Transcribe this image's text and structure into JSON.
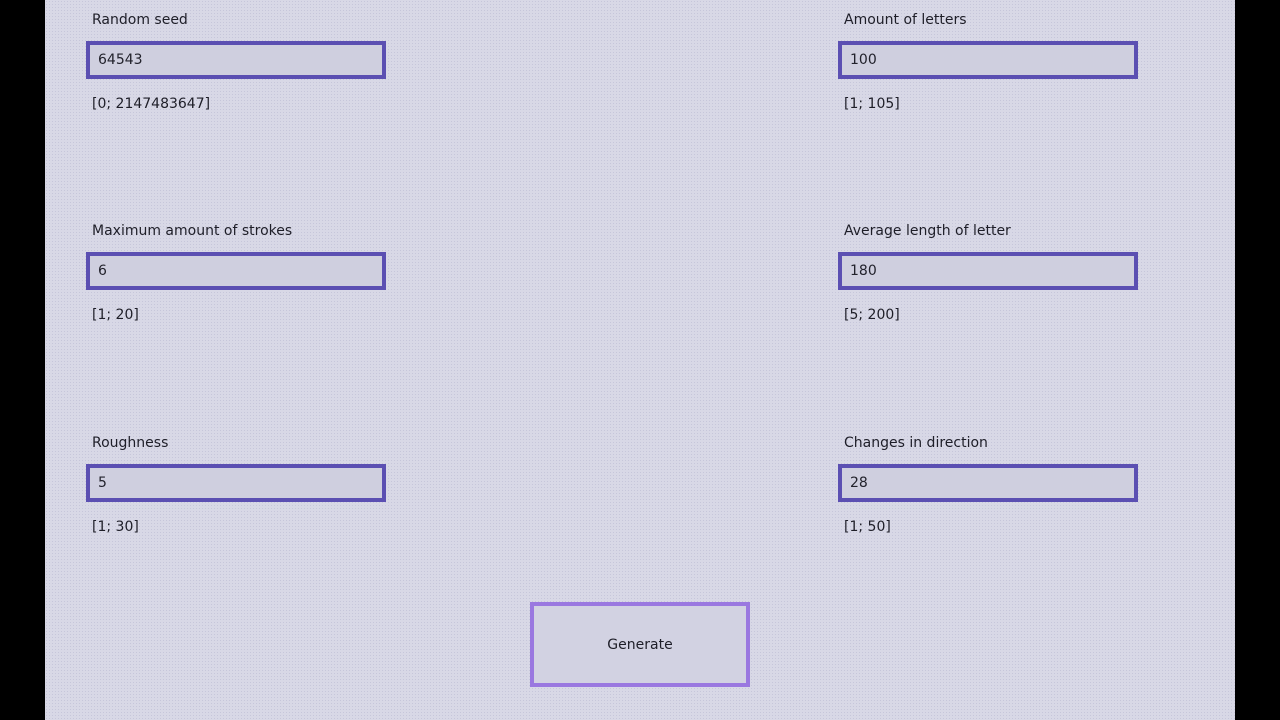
{
  "fields": [
    {
      "label": "Random seed",
      "value": "64543",
      "range": "[0; 2147483647]"
    },
    {
      "label": "Amount of letters",
      "value": "100",
      "range": "[1; 105]"
    },
    {
      "label": "Maximum amount of strokes",
      "value": "6",
      "range": "[1; 20]"
    },
    {
      "label": "Average length of letter",
      "value": "180",
      "range": "[5; 200]"
    },
    {
      "label": "Roughness",
      "value": "5",
      "range": "[1; 30]"
    },
    {
      "label": "Changes in direction",
      "value": "28",
      "range": "[1; 50]"
    }
  ],
  "generate_label": "Generate",
  "colors": {
    "frame": "#000000",
    "background": "#d8d8e6",
    "input_border": "#5b4fb2",
    "button_border": "#9a78e0"
  }
}
